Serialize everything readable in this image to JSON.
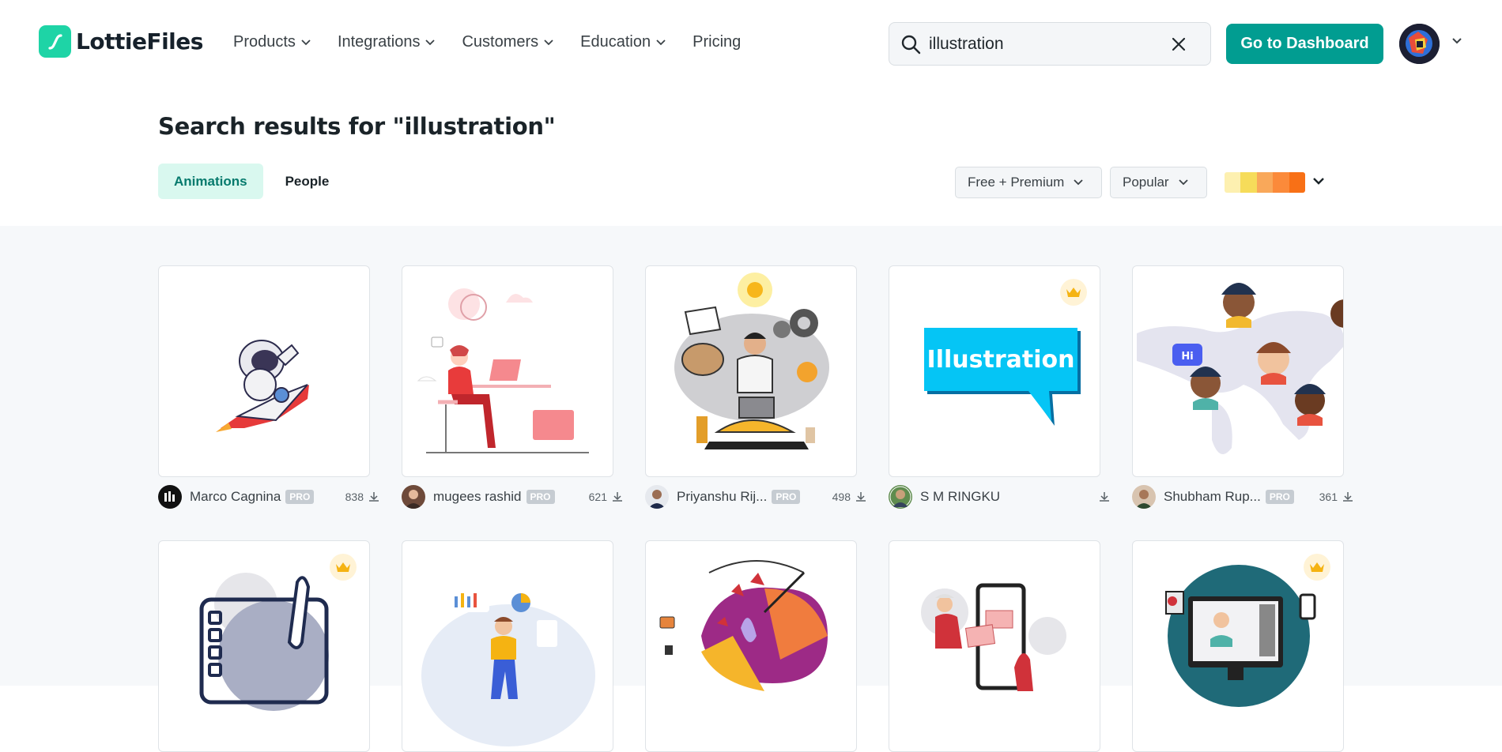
{
  "brand": {
    "name": "LottieFiles",
    "accent": "#019d91",
    "logo_color": "#1ed4a6"
  },
  "nav": [
    {
      "label": "Products",
      "has_caret": true
    },
    {
      "label": "Integrations",
      "has_caret": true
    },
    {
      "label": "Customers",
      "has_caret": true
    },
    {
      "label": "Education",
      "has_caret": true
    },
    {
      "label": "Pricing",
      "has_caret": false
    }
  ],
  "search": {
    "value": "illustration",
    "icon": "search-icon",
    "clear_icon": "close-icon"
  },
  "dashboard_button": "Go to Dashboard",
  "heading": "Search results for \"illustration\"",
  "tabs": {
    "animations": "Animations",
    "people": "People",
    "active": "animations"
  },
  "filters": {
    "license": "Free + Premium",
    "sort": "Popular",
    "palette": [
      "#fdf0b0",
      "#f6dc5a",
      "#f9a85a",
      "#fb8a3a",
      "#f87016"
    ]
  },
  "results": [
    {
      "author": "Marco Cagnina",
      "pro": "PRO",
      "downloads": "838",
      "premium": false,
      "thumb": "astronaut-rocket"
    },
    {
      "author": "mugees rashid",
      "pro": "PRO",
      "downloads": "621",
      "premium": false,
      "thumb": "woman-laptop-desk"
    },
    {
      "author": "Priyanshu Rij...",
      "pro": "PRO",
      "downloads": "498",
      "premium": false,
      "thumb": "man-laptop-ideas"
    },
    {
      "author": "S M RINGKU",
      "pro": "",
      "downloads": "",
      "premium": true,
      "thumb": "illustration-speech-bubble",
      "thumb_text": "Illustration"
    },
    {
      "author": "Shubham Rup...",
      "pro": "PRO",
      "downloads": "361",
      "premium": false,
      "thumb": "world-map-people",
      "thumb_text": "Hi"
    },
    {
      "author": "",
      "pro": "",
      "downloads": "",
      "premium": true,
      "thumb": "drawing-tablet-brush"
    },
    {
      "author": "",
      "pro": "",
      "downloads": "",
      "premium": false,
      "thumb": "analytics-person"
    },
    {
      "author": "",
      "pro": "",
      "downloads": "",
      "premium": false,
      "thumb": "abstract-art-brush"
    },
    {
      "author": "",
      "pro": "",
      "downloads": "",
      "premium": false,
      "thumb": "phone-photos-man"
    },
    {
      "author": "",
      "pro": "",
      "downloads": "",
      "premium": true,
      "thumb": "designer-desktop"
    }
  ]
}
